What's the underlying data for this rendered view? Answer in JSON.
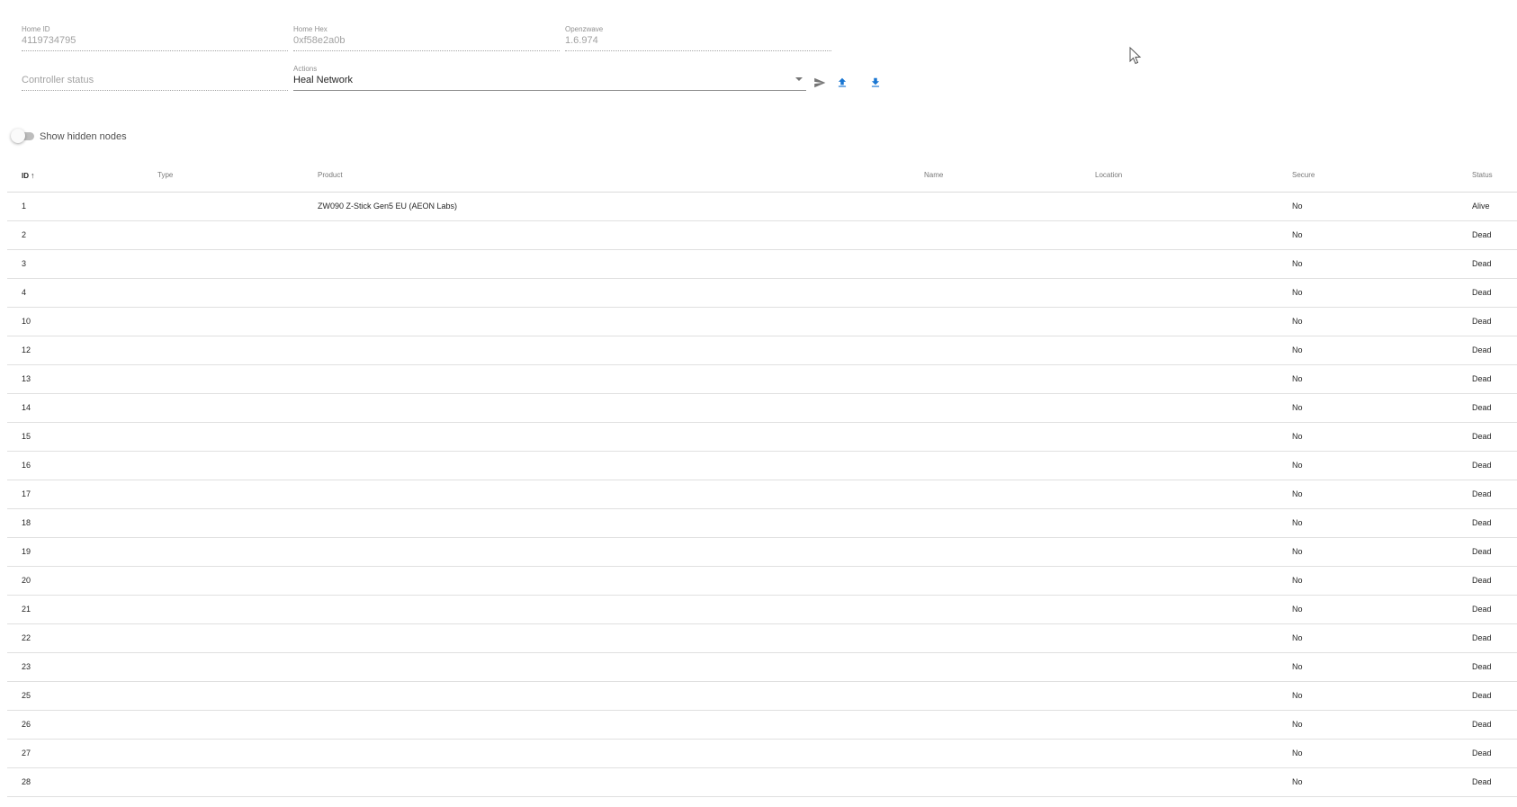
{
  "info": {
    "home_id": {
      "label": "Home ID",
      "value": "4119734795"
    },
    "home_hex": {
      "label": "Home Hex",
      "value": "0xf58e2a0b"
    },
    "openzwave": {
      "label": "Openzwave",
      "value": "1.6.974"
    }
  },
  "controller": {
    "status_placeholder": "Controller status",
    "actions_label": "Actions",
    "actions_value": "Heal Network"
  },
  "icons": {
    "send": "send-icon",
    "upload": "upload-icon",
    "download": "download-icon",
    "accent_color": "#1976d2"
  },
  "toggle": {
    "label": "Show hidden nodes",
    "checked": false
  },
  "table": {
    "headers": {
      "id": "ID",
      "type": "Type",
      "product": "Product",
      "name": "Name",
      "location": "Location",
      "secure": "Secure",
      "status": "Status"
    },
    "sort_indicator": "↑",
    "rows": [
      {
        "id": "1",
        "type": "",
        "product": "ZW090 Z-Stick Gen5 EU (AEON Labs)",
        "name": "",
        "location": "",
        "secure": "No",
        "status": "Alive"
      },
      {
        "id": "2",
        "type": "",
        "product": "",
        "name": "",
        "location": "",
        "secure": "No",
        "status": "Dead"
      },
      {
        "id": "3",
        "type": "",
        "product": "",
        "name": "",
        "location": "",
        "secure": "No",
        "status": "Dead"
      },
      {
        "id": "4",
        "type": "",
        "product": "",
        "name": "",
        "location": "",
        "secure": "No",
        "status": "Dead"
      },
      {
        "id": "10",
        "type": "",
        "product": "",
        "name": "",
        "location": "",
        "secure": "No",
        "status": "Dead"
      },
      {
        "id": "12",
        "type": "",
        "product": "",
        "name": "",
        "location": "",
        "secure": "No",
        "status": "Dead"
      },
      {
        "id": "13",
        "type": "",
        "product": "",
        "name": "",
        "location": "",
        "secure": "No",
        "status": "Dead"
      },
      {
        "id": "14",
        "type": "",
        "product": "",
        "name": "",
        "location": "",
        "secure": "No",
        "status": "Dead"
      },
      {
        "id": "15",
        "type": "",
        "product": "",
        "name": "",
        "location": "",
        "secure": "No",
        "status": "Dead"
      },
      {
        "id": "16",
        "type": "",
        "product": "",
        "name": "",
        "location": "",
        "secure": "No",
        "status": "Dead"
      },
      {
        "id": "17",
        "type": "",
        "product": "",
        "name": "",
        "location": "",
        "secure": "No",
        "status": "Dead"
      },
      {
        "id": "18",
        "type": "",
        "product": "",
        "name": "",
        "location": "",
        "secure": "No",
        "status": "Dead"
      },
      {
        "id": "19",
        "type": "",
        "product": "",
        "name": "",
        "location": "",
        "secure": "No",
        "status": "Dead"
      },
      {
        "id": "20",
        "type": "",
        "product": "",
        "name": "",
        "location": "",
        "secure": "No",
        "status": "Dead"
      },
      {
        "id": "21",
        "type": "",
        "product": "",
        "name": "",
        "location": "",
        "secure": "No",
        "status": "Dead"
      },
      {
        "id": "22",
        "type": "",
        "product": "",
        "name": "",
        "location": "",
        "secure": "No",
        "status": "Dead"
      },
      {
        "id": "23",
        "type": "",
        "product": "",
        "name": "",
        "location": "",
        "secure": "No",
        "status": "Dead"
      },
      {
        "id": "25",
        "type": "",
        "product": "",
        "name": "",
        "location": "",
        "secure": "No",
        "status": "Dead"
      },
      {
        "id": "26",
        "type": "",
        "product": "",
        "name": "",
        "location": "",
        "secure": "No",
        "status": "Dead"
      },
      {
        "id": "27",
        "type": "",
        "product": "",
        "name": "",
        "location": "",
        "secure": "No",
        "status": "Dead"
      },
      {
        "id": "28",
        "type": "",
        "product": "",
        "name": "",
        "location": "",
        "secure": "No",
        "status": "Dead"
      }
    ]
  }
}
